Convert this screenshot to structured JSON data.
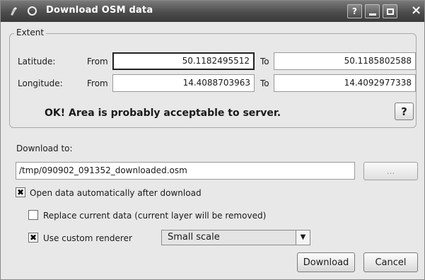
{
  "window": {
    "title": "Download OSM data",
    "help_label": "?",
    "minimize_label": "_",
    "maximize_label": "□",
    "close_label": "×"
  },
  "extent": {
    "group_title": "Extent",
    "latitude_label": "Latitude:",
    "longitude_label": "Longitude:",
    "from_label": "From",
    "to_label": "To",
    "lat_from": "50.1182495512",
    "lat_to": "50.1185802588",
    "lon_from": "14.4088703963",
    "lon_to": "14.4092977338",
    "status_message": "OK! Area is probably acceptable to server.",
    "help_button_label": "?"
  },
  "download": {
    "label": "Download to:",
    "path": "/tmp/090902_091352_downloaded.osm",
    "browse_label": "..."
  },
  "options": {
    "open_auto": {
      "label": "Open data automatically after download",
      "checked": true
    },
    "replace": {
      "label": "Replace current data (current layer will be removed)",
      "checked": false
    },
    "custom_renderer": {
      "label": "Use custom renderer",
      "checked": true
    },
    "renderer_selected": "Small scale"
  },
  "buttons": {
    "download": "Download",
    "cancel": "Cancel"
  }
}
